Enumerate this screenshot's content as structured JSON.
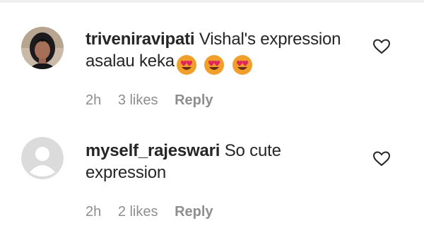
{
  "comments": [
    {
      "username": "triveniravipati",
      "text": "Vishal's expression asalau keka",
      "emoji": [
        "heart-eyes-emoji",
        "heart-eyes-emoji",
        "heart-eyes-emoji"
      ],
      "time": "2h",
      "likes": "3 likes",
      "reply_label": "Reply",
      "avatar": "profile-photo"
    },
    {
      "username": "myself_rajeswari",
      "text": "So cute expression",
      "time": "2h",
      "likes": "2 likes",
      "reply_label": "Reply",
      "avatar": "default-avatar"
    }
  ],
  "icons": {
    "like": "heart-outline-icon"
  },
  "colors": {
    "text": "#262626",
    "meta": "#8e8e8e",
    "emoji_face": "#f0a02a",
    "emoji_heart": "#e0245e",
    "default_avatar": "#dbdbdb"
  }
}
